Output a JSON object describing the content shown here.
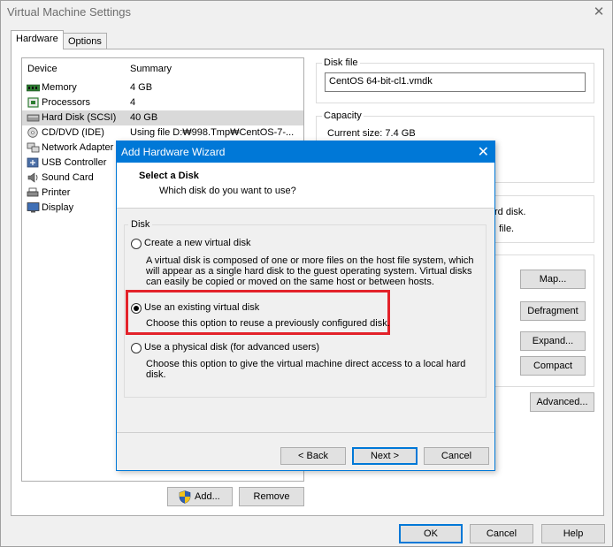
{
  "window": {
    "title": "Virtual Machine Settings",
    "close_glyph": "✕"
  },
  "tabs": [
    {
      "label": "Hardware",
      "active": true
    },
    {
      "label": "Options",
      "active": false
    }
  ],
  "device_list": {
    "header_device": "Device",
    "header_summary": "Summary",
    "items": [
      {
        "name": "Memory",
        "summary": "4 GB",
        "icon": "memory-icon"
      },
      {
        "name": "Processors",
        "summary": "4",
        "icon": "processor-icon"
      },
      {
        "name": "Hard Disk (SCSI)",
        "summary": "40 GB",
        "icon": "hard-disk-icon",
        "selected": true
      },
      {
        "name": "CD/DVD (IDE)",
        "summary": "Using file D:₩998.Tmp₩CentOS-7-...",
        "icon": "cd-dvd-icon"
      },
      {
        "name": "Network Adapter",
        "summary": "",
        "icon": "network-adapter-icon"
      },
      {
        "name": "USB Controller",
        "summary": "",
        "icon": "usb-icon"
      },
      {
        "name": "Sound Card",
        "summary": "",
        "icon": "sound-card-icon"
      },
      {
        "name": "Printer",
        "summary": "",
        "icon": "printer-icon"
      },
      {
        "name": "Display",
        "summary": "",
        "icon": "display-icon"
      }
    ]
  },
  "disk_file": {
    "label": "Disk file",
    "value": "CentOS 64-bit-cl1.vmdk"
  },
  "capacity": {
    "label": "Capacity",
    "current_size": "Current size:  7.4 GB"
  },
  "partial_texts": {
    "line1": "rd disk.",
    "line2": "file."
  },
  "side_buttons": {
    "map": "Map...",
    "defragment": "Defragment",
    "expand": "Expand...",
    "compact": "Compact",
    "advanced": "Advanced..."
  },
  "list_buttons": {
    "add": "Add...",
    "remove": "Remove"
  },
  "footer_buttons": {
    "ok": "OK",
    "cancel": "Cancel",
    "help": "Help"
  },
  "wizard": {
    "title": "Add Hardware Wizard",
    "close_glyph": "✕",
    "heading": "Select a Disk",
    "subheading": "Which disk do you want to use?",
    "group_label": "Disk",
    "options": [
      {
        "label": "Create a new virtual disk",
        "checked": false,
        "desc": [
          "A virtual disk is composed of one or more files on the host file system, which",
          "will appear as a single hard disk to the guest operating system. Virtual disks",
          "can easily be copied or moved on the same host or between hosts."
        ]
      },
      {
        "label": "Use an existing virtual disk",
        "checked": true,
        "desc": [
          "Choose this option to reuse a previously configured disk."
        ]
      },
      {
        "label": "Use a physical disk (for advanced users)",
        "checked": false,
        "desc": [
          "Choose this option to give the virtual machine direct access to a local hard",
          "disk."
        ]
      }
    ],
    "buttons": {
      "back": "< Back",
      "next": "Next >",
      "cancel": "Cancel"
    },
    "highlight_color": "#e3222a",
    "accent_color": "#0078d7"
  }
}
